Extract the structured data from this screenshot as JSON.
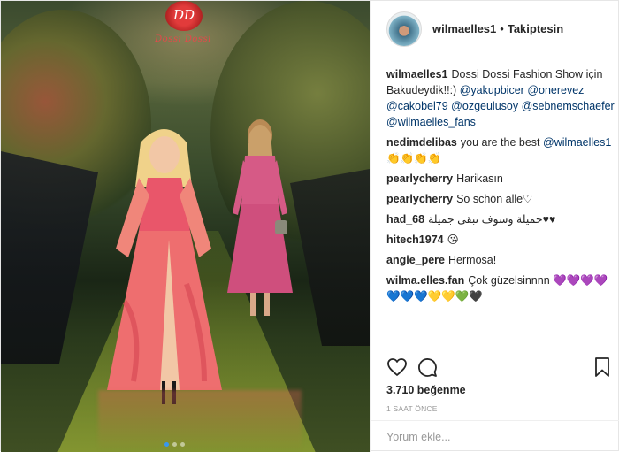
{
  "post": {
    "photo": {
      "logo_monogram": "DD",
      "logo_word": "Dossi Dossi",
      "carousel_dots": 3,
      "active_dot": 1
    },
    "header": {
      "username": "wilmaelles1",
      "separator": "•",
      "follow_status": "Takiptesin"
    },
    "comments": [
      {
        "user": "wilmaelles1",
        "parts": [
          {
            "t": "Dossi Dossi Fashion Show için Bakudeydik!!:) ",
            "m": false
          },
          {
            "t": "@yakupbicer",
            "m": true
          },
          {
            "t": " ",
            "m": false
          },
          {
            "t": "@onerevez",
            "m": true
          },
          {
            "t": " ",
            "m": false
          },
          {
            "t": "@cakobel79",
            "m": true
          },
          {
            "t": " ",
            "m": false
          },
          {
            "t": "@ozgeulusoy",
            "m": true
          },
          {
            "t": " ",
            "m": false
          },
          {
            "t": "@sebnemschaefer",
            "m": true
          },
          {
            "t": " ",
            "m": false
          },
          {
            "t": "@wilmaelles_fans",
            "m": true
          }
        ]
      },
      {
        "user": "nedimdelibas",
        "parts": [
          {
            "t": "you are the best ",
            "m": false
          },
          {
            "t": "@wilmaelles1",
            "m": true
          },
          {
            "t": " 👏👏👏👏",
            "m": false
          }
        ]
      },
      {
        "user": "pearlycherry",
        "parts": [
          {
            "t": "Harikasın",
            "m": false
          }
        ]
      },
      {
        "user": "pearlycherry",
        "parts": [
          {
            "t": "So schön alle♡",
            "m": false
          }
        ]
      },
      {
        "user": "had_68",
        "parts": [
          {
            "t": "جميلة وسوف تبقى جميلة♥♥",
            "m": false
          }
        ]
      },
      {
        "user": "hitech1974",
        "parts": [
          {
            "t": "😘",
            "m": false
          }
        ]
      },
      {
        "user": "angie_pere",
        "parts": [
          {
            "t": "Hermosa!",
            "m": false
          }
        ]
      },
      {
        "user": "wilma.elles.fan",
        "parts": [
          {
            "t": "Çok güzelsinnnn 💜💜💜💜💙💙💙💛💛💚🖤",
            "m": false
          }
        ]
      }
    ],
    "actions": {
      "like_icon": "heart-outline-icon",
      "comment_icon": "speech-bubble-icon",
      "save_icon": "bookmark-outline-icon"
    },
    "likes_text": "3.710 beğenme",
    "timestamp": "1 SAAT ÖNCE",
    "add_comment_placeholder": "Yorum ekle...",
    "colors": {
      "mention": "#003569",
      "text": "#262626",
      "muted": "#999999",
      "dot_active": "#3897f0"
    }
  }
}
